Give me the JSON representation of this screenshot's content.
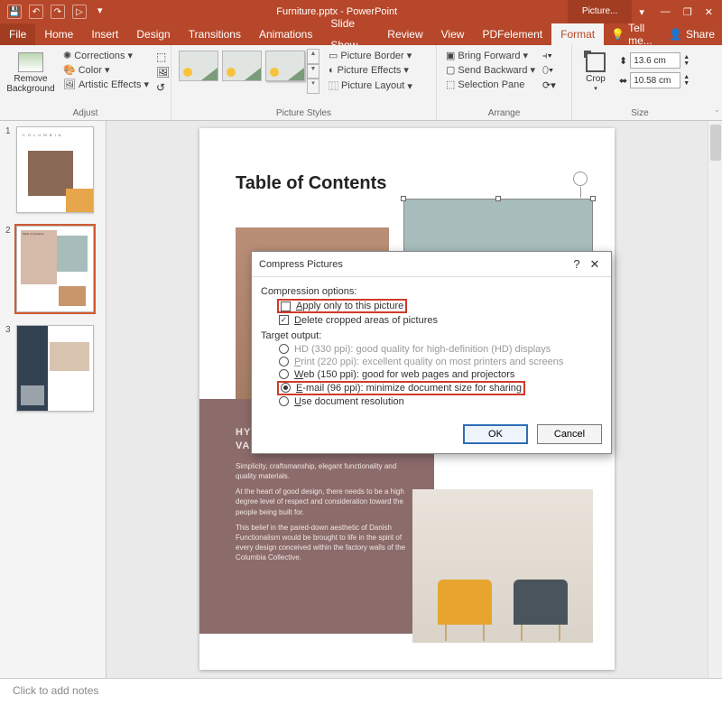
{
  "titlebar": {
    "doc_title": "Furniture.pptx - PowerPoint",
    "context_tab_group": "Picture..."
  },
  "window_controls": {
    "min": "—",
    "max": "❐",
    "close": "✕",
    "ribbon_opts": "▾"
  },
  "qat": {
    "save": "💾",
    "undo": "↶",
    "redo": "↷",
    "start": "▷",
    "more": "▾"
  },
  "tabs": {
    "file": "File",
    "home": "Home",
    "insert": "Insert",
    "design": "Design",
    "transitions": "Transitions",
    "animations": "Animations",
    "slideshow": "Slide Show",
    "review": "Review",
    "view": "View",
    "pdfelement": "PDFelement",
    "format": "Format",
    "tellme": "Tell me...",
    "share": "Share"
  },
  "ribbon": {
    "adjust": {
      "label": "Adjust",
      "remove_bg": "Remove Background",
      "corrections": "Corrections",
      "color": "Color",
      "artistic": "Artistic Effects"
    },
    "styles": {
      "label": "Picture Styles",
      "border": "Picture Border",
      "effects": "Picture Effects",
      "layout": "Picture Layout"
    },
    "arrange": {
      "label": "Arrange",
      "bring_forward": "Bring Forward",
      "send_backward": "Send Backward",
      "selection_pane": "Selection Pane"
    },
    "size": {
      "label": "Size",
      "crop": "Crop",
      "height": "13.6 cm",
      "width": "10.58 cm"
    }
  },
  "thumbs": {
    "n1": "1",
    "n2": "2",
    "n3": "3",
    "t2_label": "Table of Contents"
  },
  "slide": {
    "title": "Table of Contents",
    "design_heading": "HYGGE-CENTRIC DESIGN VALUES",
    "p1": "Simplicity, craftsmanship, elegant functionality and quality materials.",
    "p2": "At the heart of good design, there needs to be a high degree level of respect and consideration toward the people being built for.",
    "p3": "This belief in the pared-down aesthetic of Danish Functionalism would be brought to life in the spirit of every design conceived within the factory walls of the Columbia Collective."
  },
  "dialog": {
    "title": "Compress Pictures",
    "help": "?",
    "close": "✕",
    "compression_label": "Compression options:",
    "apply_only": "pply only to this picture",
    "apply_only_u": "A",
    "delete_cropped": "elete cropped areas of pictures",
    "delete_cropped_u": "D",
    "target_label": "Target output:",
    "hd_pre": "HD (330 ppi): good quality for high-definition (HD) displays",
    "print_u": "P",
    "print_rest": "rint (220 ppi): excellent quality on most printers and screens",
    "web_u": "W",
    "web_rest": "eb (150 ppi): good for web pages and projectors",
    "email_u": "E",
    "email_rest": "-mail (96 ppi): minimize document size for sharing",
    "docres_u": "U",
    "docres_rest": "se document resolution",
    "ok": "OK",
    "cancel": "Cancel"
  },
  "notes": {
    "placeholder": "Click to add notes"
  }
}
